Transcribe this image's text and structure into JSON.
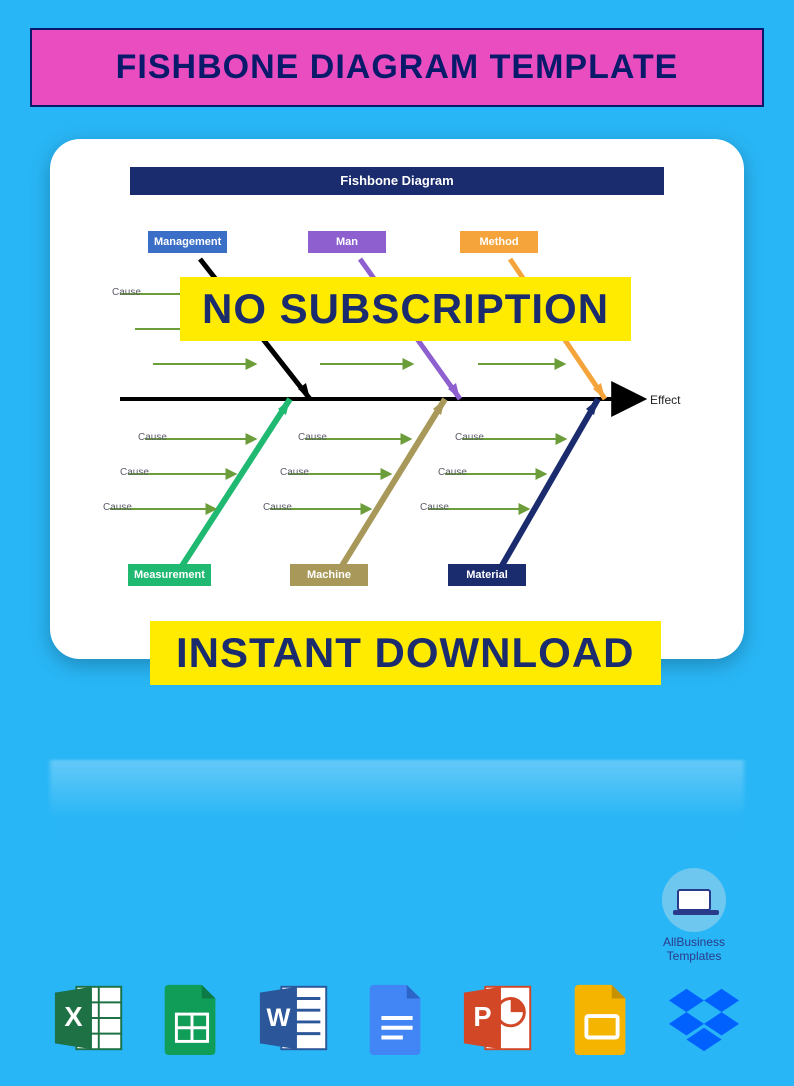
{
  "title": "FISHBONE DIAGRAM TEMPLATE",
  "diagram": {
    "header": "Fishbone Diagram",
    "effect": "Effect",
    "cause": "Cause",
    "categories_top": [
      {
        "name": "Management",
        "color": "#3b6fc7"
      },
      {
        "name": "Man",
        "color": "#8d5fcf"
      },
      {
        "name": "Method",
        "color": "#f4a43a"
      }
    ],
    "categories_bottom": [
      {
        "name": "Measurement",
        "color": "#1fb971"
      },
      {
        "name": "Machine",
        "color": "#a8995a"
      },
      {
        "name": "Material",
        "color": "#1a2b6e"
      }
    ]
  },
  "overlays": {
    "no_sub": "NO SUBSCRIPTION",
    "instant": "INSTANT DOWNLOAD"
  },
  "brand": {
    "line1": "AllBusiness",
    "line2": "Templates"
  },
  "apps": [
    "excel",
    "sheets",
    "word",
    "docs",
    "powerpoint",
    "slides",
    "dropbox"
  ]
}
